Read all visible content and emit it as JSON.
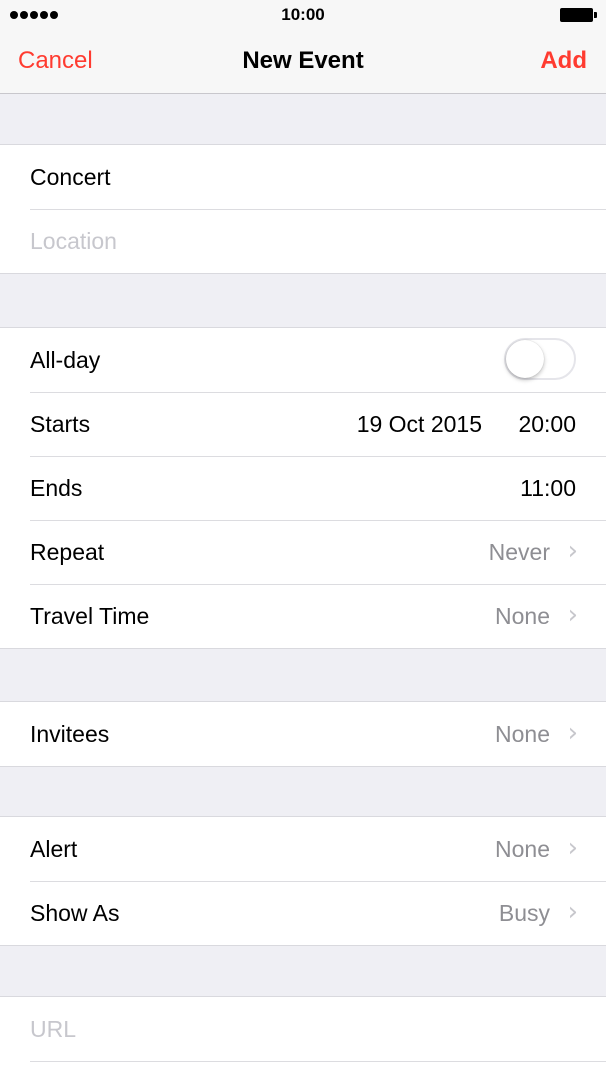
{
  "status_bar": {
    "time": "10:00",
    "signal_icon": "signal-dots-icon",
    "battery_icon": "battery-icon"
  },
  "nav": {
    "cancel_label": "Cancel",
    "title": "New Event",
    "add_label": "Add"
  },
  "title_group": {
    "title_value": "Concert",
    "location_placeholder": "Location"
  },
  "time_group": {
    "all_day_label": "All-day",
    "all_day_on": false,
    "starts_label": "Starts",
    "starts_date": "19 Oct 2015",
    "starts_time": "20:00",
    "ends_label": "Ends",
    "ends_time": "11:00",
    "repeat_label": "Repeat",
    "repeat_value": "Never",
    "travel_label": "Travel Time",
    "travel_value": "None"
  },
  "invitees_group": {
    "invitees_label": "Invitees",
    "invitees_value": "None"
  },
  "alert_group": {
    "alert_label": "Alert",
    "alert_value": "None",
    "show_as_label": "Show As",
    "show_as_value": "Busy"
  },
  "url_group": {
    "url_placeholder": "URL"
  },
  "colors": {
    "accent": "#ff3b30",
    "secondary_text": "#8e8e93",
    "placeholder": "#c7c7cd",
    "background": "#efeff4"
  }
}
